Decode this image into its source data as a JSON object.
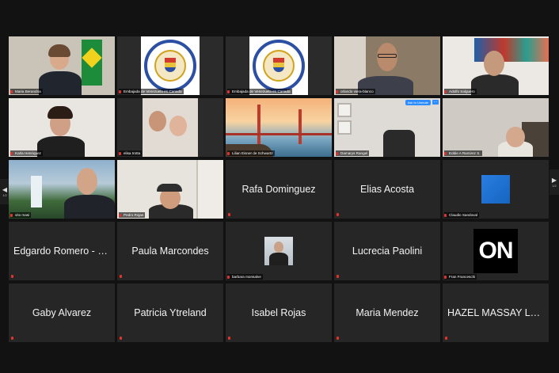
{
  "app": {
    "accent": "#2d8cff",
    "mic_muted_color": "#e0322e"
  },
  "nav": {
    "page_left": "1/2",
    "page_right": "1/2"
  },
  "row1": [
    {
      "name": "Maria Berandria"
    },
    {
      "name": "Embajada de Venezuela en Canada"
    },
    {
      "name": "Embajada de Venezuela en Canada"
    },
    {
      "name": "orlando viera-blanco"
    },
    {
      "name": "Adolfo Salguero"
    }
  ],
  "row2": [
    {
      "name": "Karla Henriquez"
    },
    {
      "name": "elisa trotta"
    },
    {
      "name": "Lilian Eisner de Schwartz"
    },
    {
      "name": "Damarys Rangel",
      "ask_unmute": "Ask to Unmute",
      "more": "..."
    },
    {
      "name": "Eddie A Ramirez S."
    }
  ],
  "row3": [
    {
      "name": "vito masi"
    },
    {
      "name": "Pedro Rojas"
    },
    {
      "name": "Rafa Dominguez"
    },
    {
      "name": "Elias Acosta"
    },
    {
      "name": "Claudio Sandoval"
    }
  ],
  "row4": [
    {
      "name": "Edgardo Romero - E..."
    },
    {
      "name": "Paula Marcondes"
    },
    {
      "name": "barbara monsalve"
    },
    {
      "name": "Lucrecia Paolini"
    },
    {
      "name": "Fran Franceschi",
      "logo_text": "ON"
    }
  ],
  "row5": [
    {
      "name": "Gaby Alvarez"
    },
    {
      "name": "Patricia Ytreland"
    },
    {
      "name": "Isabel Rojas"
    },
    {
      "name": "Maria Mendez"
    },
    {
      "name": "HAZEL MASSAY LA..."
    }
  ]
}
